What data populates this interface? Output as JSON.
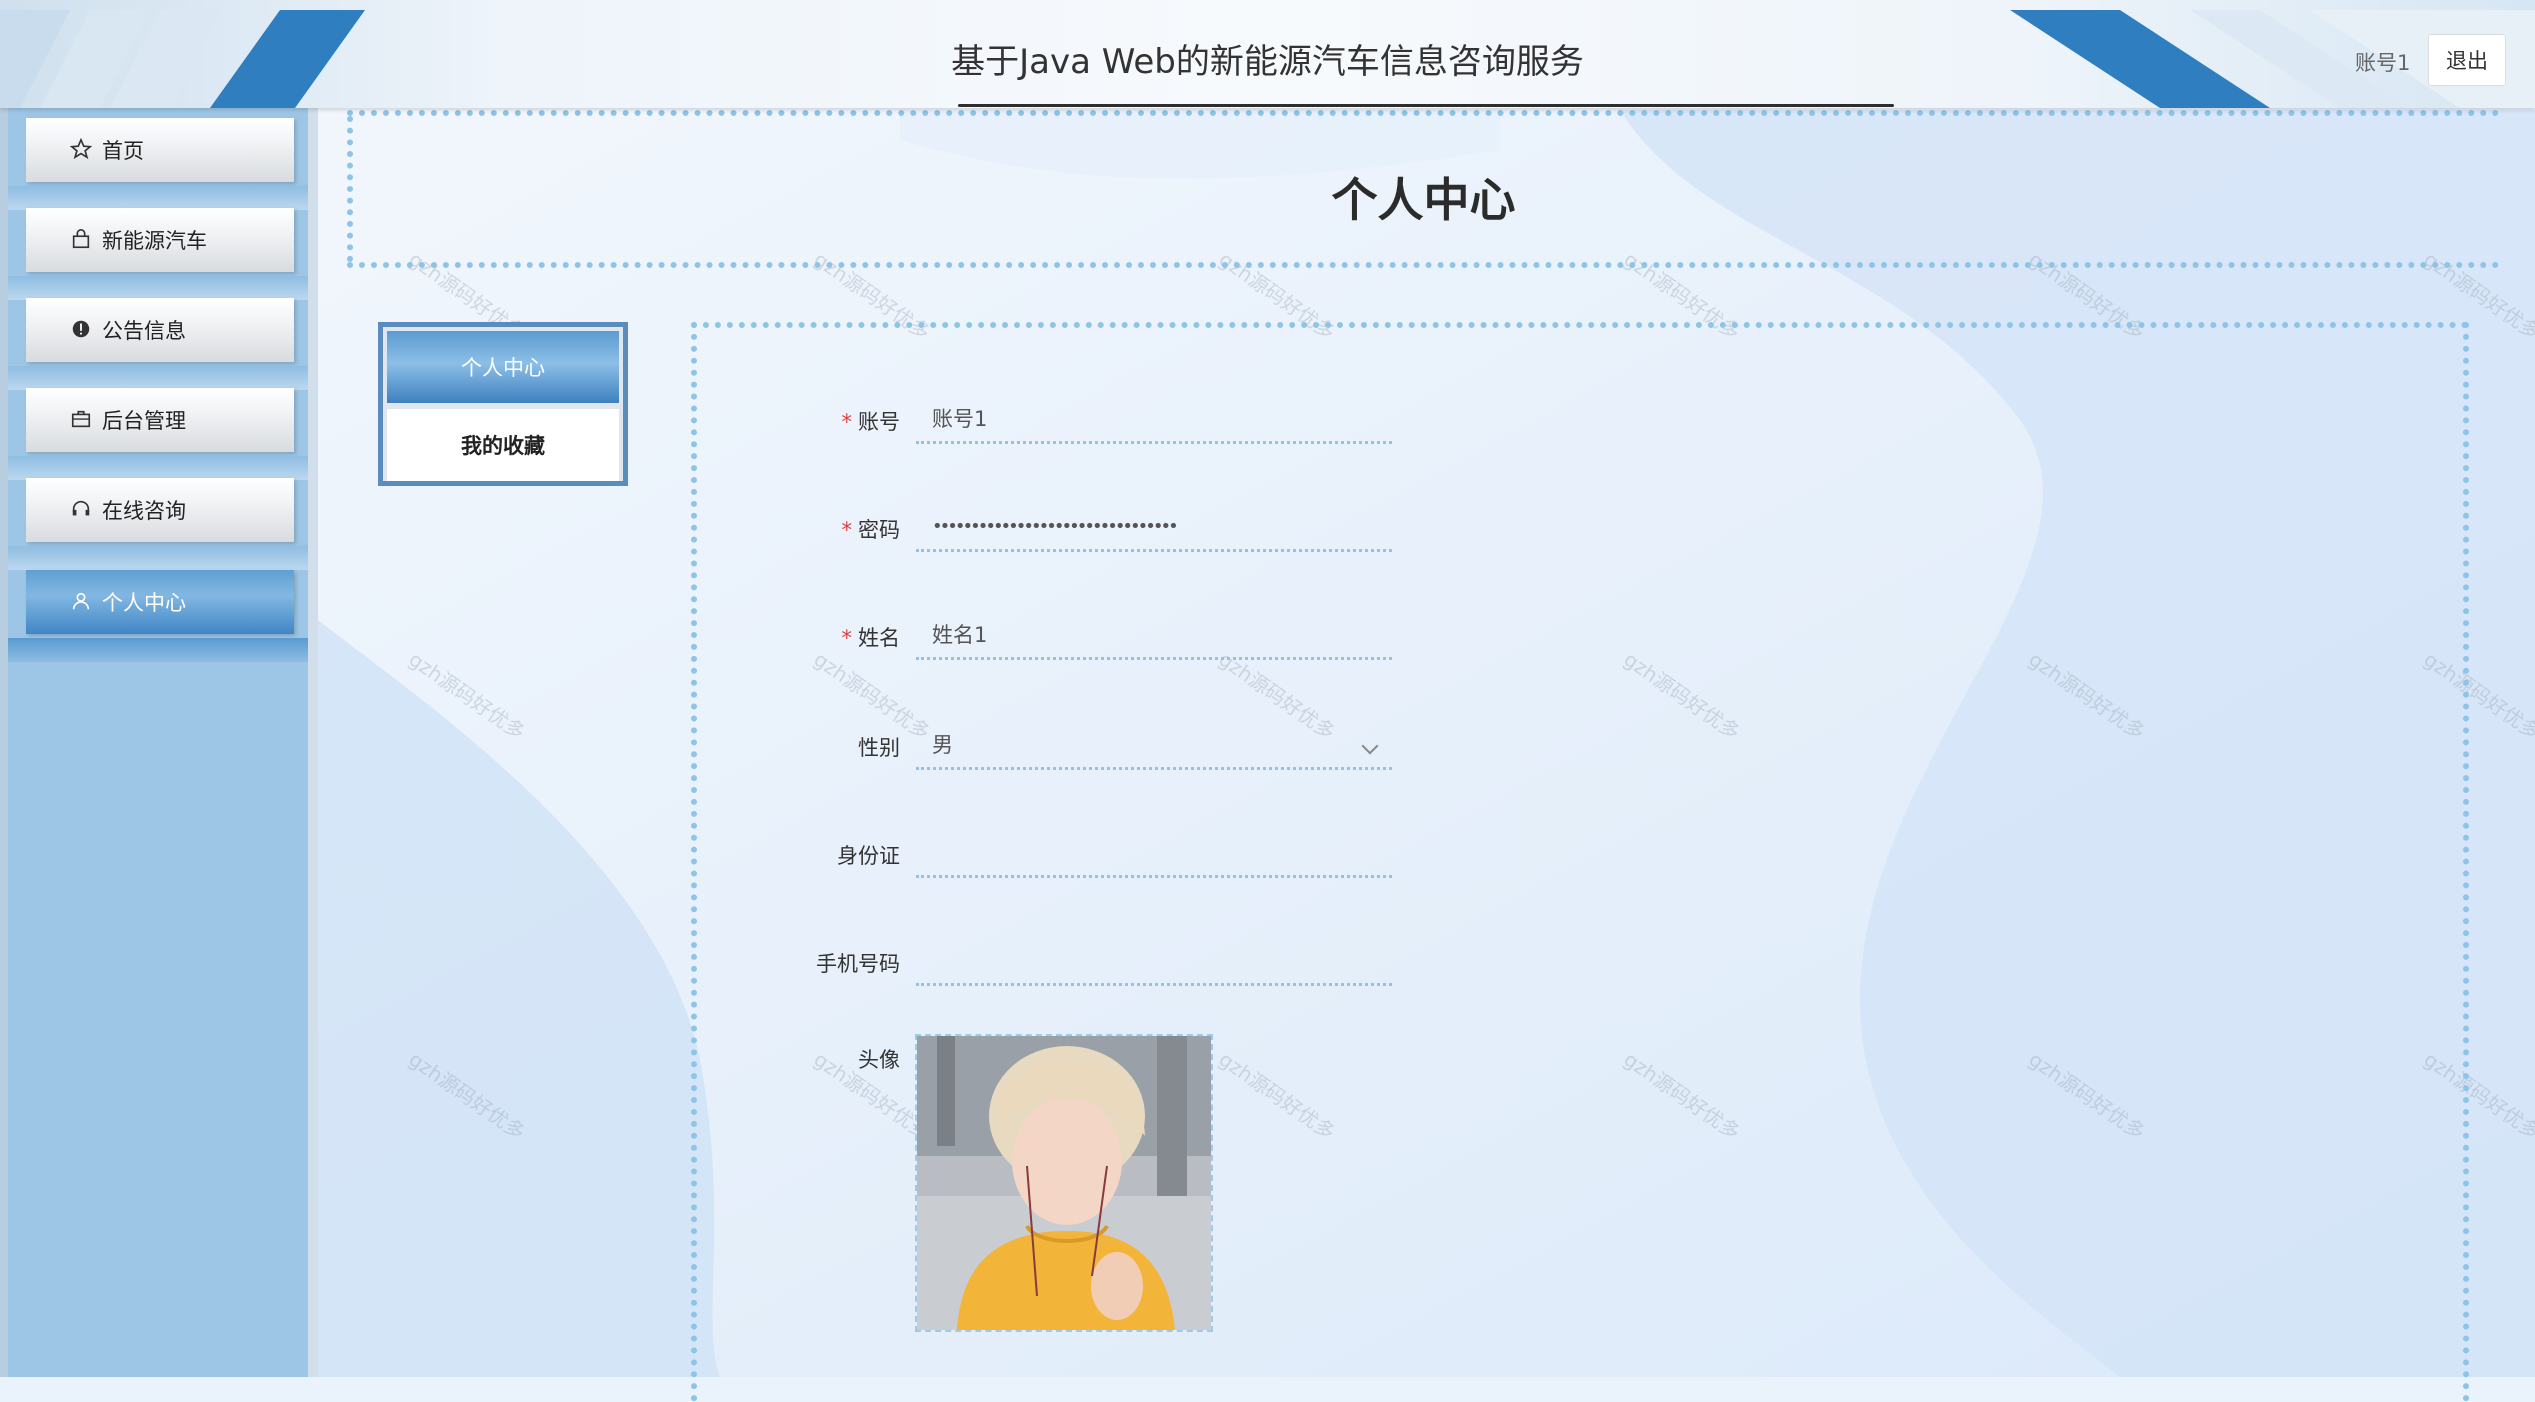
{
  "header": {
    "title": "基于Java Web的新能源汽车信息咨询服务",
    "username": "账号1",
    "logout_label": "退出"
  },
  "sidebar": {
    "items": [
      {
        "label": "首页",
        "icon": "star-icon"
      },
      {
        "label": "新能源汽车",
        "icon": "bag-icon"
      },
      {
        "label": "公告信息",
        "icon": "info-icon"
      },
      {
        "label": "后台管理",
        "icon": "briefcase-icon"
      },
      {
        "label": "在线咨询",
        "icon": "headset-icon"
      },
      {
        "label": "个人中心",
        "icon": "user-icon",
        "active": true
      }
    ]
  },
  "page": {
    "title": "个人中心"
  },
  "tabs": {
    "profile_label": "个人中心",
    "favorites_label": "我的收藏"
  },
  "form": {
    "account": {
      "label": "账号",
      "value": "账号1"
    },
    "password": {
      "label": "密码",
      "value": "••••••••••••••••••••••••••••••••"
    },
    "name": {
      "label": "姓名",
      "value": "姓名1"
    },
    "gender": {
      "label": "性别",
      "value": "男"
    },
    "idcard": {
      "label": "身份证",
      "value": ""
    },
    "phone": {
      "label": "手机号码",
      "value": ""
    },
    "avatar": {
      "label": "头像"
    }
  },
  "watermark_text": "gzh源码好优多",
  "colors": {
    "accent": "#3f86c5",
    "dotted_border": "#8ec4e6",
    "sidebar_bg": "#9dc6e6",
    "required": "#e23d3d"
  }
}
